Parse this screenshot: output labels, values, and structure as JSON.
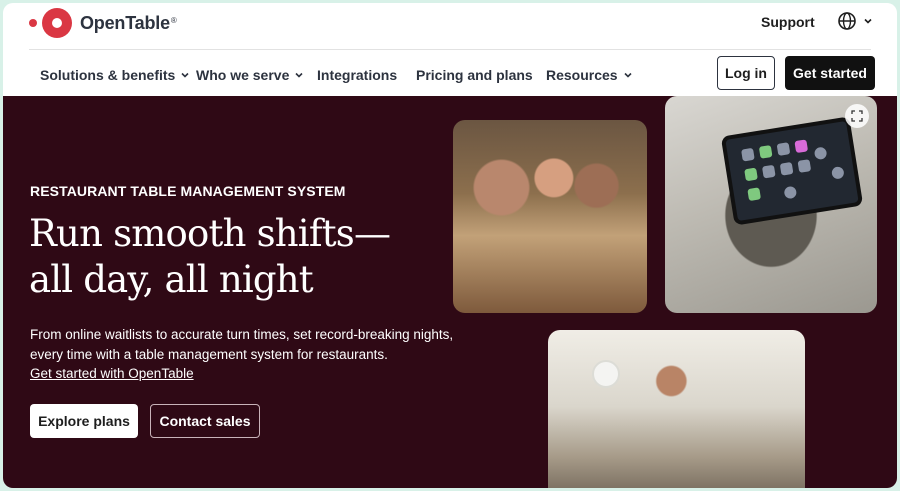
{
  "brand": {
    "name": "OpenTable",
    "color": "#da3743"
  },
  "topbar": {
    "support_label": "Support",
    "language_icon": "globe-icon"
  },
  "nav": {
    "items": [
      {
        "label": "Solutions & benefits",
        "has_dropdown": true
      },
      {
        "label": "Who we serve",
        "has_dropdown": true
      },
      {
        "label": "Integrations",
        "has_dropdown": false
      },
      {
        "label": "Pricing and plans",
        "has_dropdown": false
      },
      {
        "label": "Resources",
        "has_dropdown": true
      }
    ],
    "login_label": "Log in",
    "get_started_label": "Get started"
  },
  "hero": {
    "eyebrow": "RESTAURANT TABLE MANAGEMENT SYSTEM",
    "headline_line1": "Run smooth shifts—",
    "headline_line2": "all day, all night",
    "description": "From online waitlists to accurate turn times, set record-breaking nights, every time with a table management system for restaurants.",
    "link_label": "Get started with OpenTable",
    "explore_label": "Explore plans",
    "contact_label": "Contact sales",
    "background_color": "#2f0915"
  }
}
